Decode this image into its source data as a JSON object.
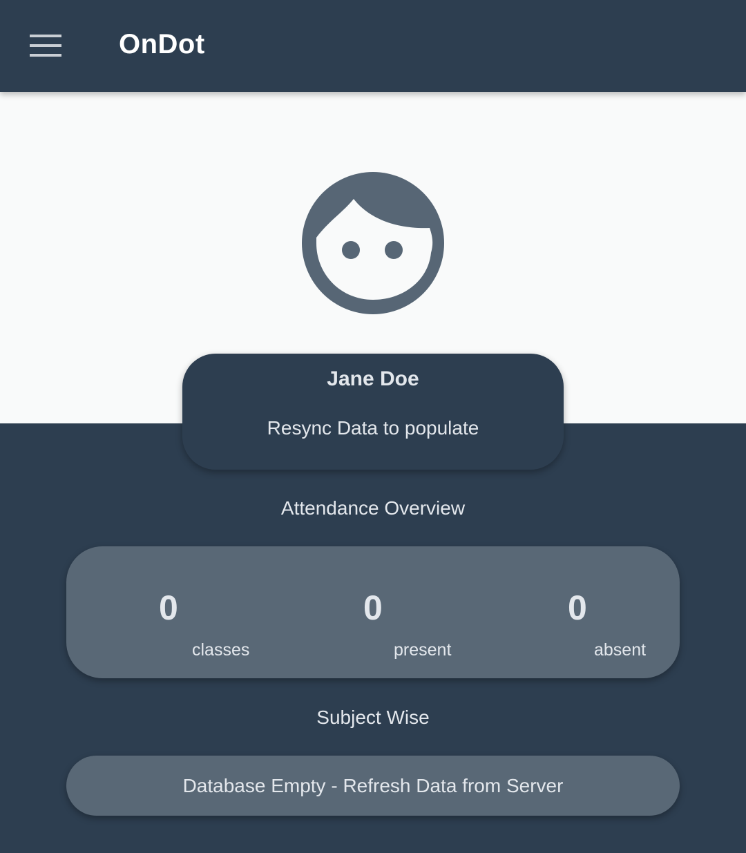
{
  "app": {
    "title": "OnDot",
    "menu_icon": "hamburger-menu-icon"
  },
  "profile": {
    "avatar_icon": "face-icon",
    "name": "Jane Doe",
    "subtitle": "Resync Data to populate"
  },
  "attendance": {
    "heading": "Attendance Overview",
    "stats": [
      {
        "value": "0",
        "label": "classes"
      },
      {
        "value": "0",
        "label": "present"
      },
      {
        "value": "0",
        "label": "absent"
      }
    ]
  },
  "subjects": {
    "heading": "Subject Wise",
    "empty_message": "Database Empty - Refresh Data from Server"
  },
  "colors": {
    "primary_dark": "#2d3e50",
    "card_gray": "#596876",
    "hero_background": "#f9fafa",
    "text_light": "#e3e7ec"
  }
}
